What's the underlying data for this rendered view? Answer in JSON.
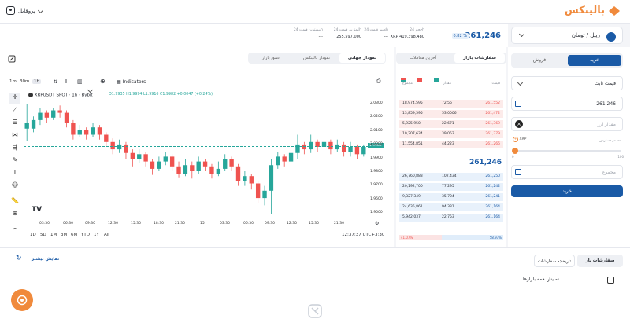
{
  "header": {
    "logo_text": "بالینکس",
    "profile_label": "پروفایل"
  },
  "market": {
    "pair": "ریپل / تومان",
    "price": "261,246",
    "change": "0.82 %"
  },
  "stats": [
    {
      "label": "حجم 24h",
      "value": "XRP 419,398,480"
    },
    {
      "label": "تغییر قیمت 24h",
      "value": "---"
    },
    {
      "label": "کمترین قیمت 24h",
      "value": "255,597,000"
    },
    {
      "label": "بیشترین قیمت 24h",
      "value": "---"
    }
  ],
  "trade": {
    "buy_tab": "خرید",
    "sell_tab": "فروش",
    "order_type": "قیمت ثابت",
    "price_value": "261,246",
    "amount_placeholder": "مقدار ارز",
    "available_label": "در دسترس",
    "available_value": "---",
    "slider_label": "XRP",
    "slider_min": "0",
    "slider_max": "100",
    "total_placeholder": "مجموع",
    "submit": "خرید"
  },
  "orderbook": {
    "tabs": [
      "سفارشات بازار",
      "آخرین معاملات"
    ],
    "headers": [
      "قیمت",
      "مقدار",
      "مجموع"
    ],
    "asks": [
      {
        "price": "261,552",
        "amount": "72.56",
        "total": "18,974,595"
      },
      {
        "price": "261,472",
        "amount": "53.0006",
        "total": "13,859,595"
      },
      {
        "price": "261,369",
        "amount": "22.671",
        "total": "5,925,950"
      },
      {
        "price": "261,379",
        "amount": "39.053",
        "total": "10,207,634"
      },
      {
        "price": "261,266",
        "amount": "44.223",
        "total": "11,554,851"
      }
    ],
    "mid_price": "261,246",
    "bids": [
      {
        "price": "261,250",
        "amount": "102.434",
        "total": "26,760,883"
      },
      {
        "price": "261,242",
        "amount": "77.295",
        "total": "20,192,700"
      },
      {
        "price": "261,241",
        "amount": "35.704",
        "total": "9,327,349"
      },
      {
        "price": "261,164",
        "amount": "94.331",
        "total": "24,635,861"
      },
      {
        "price": "261,164",
        "amount": "22.753",
        "total": "5,942,037"
      }
    ],
    "ratio_buy": "58.93%",
    "ratio_sell": "41.07%"
  },
  "chart": {
    "tabs": [
      "نمودار جهانی",
      "نمودار بالینکس",
      "عمق بازار"
    ],
    "timeframes": [
      "1m",
      "30m",
      "1h"
    ],
    "indicators_label": "Indicators",
    "symbol": "XRPUSDT SPOT · 1h · Bybit",
    "ohlc": "O1.9935 H1.9994 L1.9916 C1.9982 +0.0047 (+0.24%)",
    "last_price_tag": "1.9982",
    "range_buttons": [
      "1D",
      "5D",
      "1M",
      "3M",
      "6M",
      "YTD",
      "1Y",
      "All"
    ],
    "clock": "12:37:37 UTC+3:30",
    "y_ticks": [
      "2.0300",
      "2.0200",
      "2.0100",
      "2.0000",
      "1.9900",
      "1.9800",
      "1.9700",
      "1.9600",
      "1.9500"
    ],
    "x_ticks": [
      "03:30",
      "06:30",
      "09:30",
      "12:30",
      "15:30",
      "18:30",
      "21:30",
      "15",
      "03:30",
      "06:30",
      "09:30",
      "12:30",
      "15:30",
      "21:30"
    ]
  },
  "bottom": {
    "tab_active": "سفارشات باز",
    "tab_other": "تاریخچه سفارشات",
    "show_more": "نمایش بیشتر",
    "show_all_markets": "نمایش همه بازارها"
  },
  "colors": {
    "brand": "#1a5aa6",
    "accent": "#f08a3c",
    "up": "#26a69a",
    "down": "#ef5350"
  }
}
